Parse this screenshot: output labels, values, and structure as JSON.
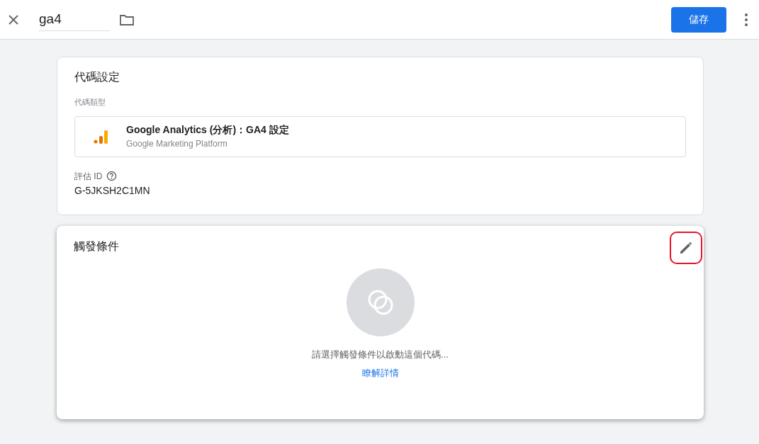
{
  "header": {
    "name_value": "ga4",
    "save_button": "儲存"
  },
  "tag_config": {
    "title": "代碼設定",
    "type_label": "代碼類型",
    "tag_type": {
      "name": "Google Analytics (分析)：GA4 設定",
      "provider": "Google Marketing Platform"
    },
    "id_label": "評估 ID",
    "id_value": "G-5JKSH2C1MN"
  },
  "triggering": {
    "title": "觸發條件",
    "edit_highlighted": true,
    "empty_message": "請選擇觸發條件以啟動這個代碼...",
    "learn_more": "瞭解詳情"
  }
}
